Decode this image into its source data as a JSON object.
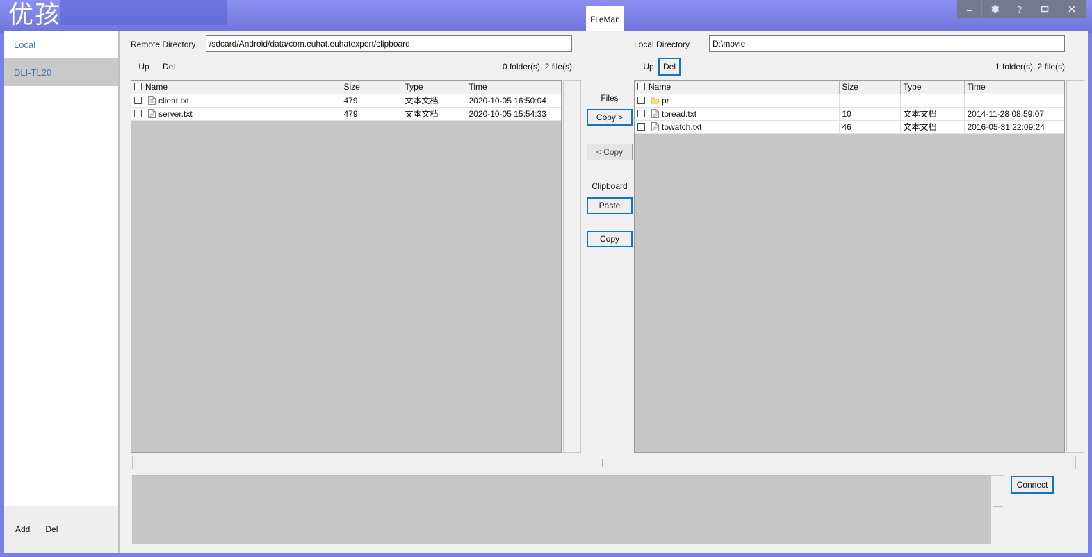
{
  "window": {
    "logo_text": "优孩",
    "controls": [
      {
        "name": "minimize",
        "glyph": "minimize-icon"
      },
      {
        "name": "settings",
        "glyph": "gear-icon"
      },
      {
        "name": "help",
        "glyph": "question-icon"
      },
      {
        "name": "maximize",
        "glyph": "maximize-icon"
      },
      {
        "name": "close",
        "glyph": "close-icon"
      }
    ]
  },
  "tab": {
    "label": "FileMan"
  },
  "sidebar": {
    "items": [
      {
        "label": "Local",
        "selected": false
      },
      {
        "label": "DLI-TL20",
        "selected": true
      }
    ],
    "footer": {
      "add_label": "Add",
      "del_label": "Del"
    }
  },
  "remote": {
    "dir_label": "Remote Directory",
    "dir_value": "/sdcard/Android/data/com.euhat.euhatexpert/clipboard",
    "up_label": "Up",
    "del_label": "Del",
    "count_text": "0 folder(s), 2 file(s)",
    "columns": [
      "Name",
      "Size",
      "Type",
      "Time"
    ],
    "rows": [
      {
        "icon": "file-icon",
        "name": "client.txt",
        "size": "479",
        "type": "文本文档",
        "time": "2020-10-05 16:50:04"
      },
      {
        "icon": "file-icon",
        "name": "server.txt",
        "size": "479",
        "type": "文本文档",
        "time": "2020-10-05 15:54:33"
      }
    ]
  },
  "local": {
    "dir_label": "Local Directory",
    "dir_value": "D:\\movie",
    "up_label": "Up",
    "del_label": "Del",
    "count_text": "1 folder(s), 2 file(s)",
    "columns": [
      "Name",
      "Size",
      "Type",
      "Time"
    ],
    "rows": [
      {
        "icon": "folder-icon",
        "name": "pr",
        "size": "",
        "type": "",
        "time": ""
      },
      {
        "icon": "file-icon",
        "name": "toread.txt",
        "size": "10",
        "type": "文本文档",
        "time": "2014-11-28 08:59:07"
      },
      {
        "icon": "file-icon",
        "name": "towatch.txt",
        "size": "46",
        "type": "文本文档",
        "time": "2016-05-31 22:09:24"
      }
    ]
  },
  "center": {
    "files_label": "Files",
    "copy_right_label": "Copy >",
    "copy_left_label": "< Copy",
    "clipboard_label": "Clipboard",
    "paste_label": "Paste",
    "copy_label": "Copy"
  },
  "bottom": {
    "splitter_grip": "||",
    "connect_label": "Connect",
    "log_text": ""
  },
  "colors": {
    "titlebar_top": "#8b8ff2",
    "titlebar_bottom": "#6f74d8",
    "accent_focus": "#1673c4",
    "sidebar_link": "#3d7ab5",
    "sidebar_selected_bg": "#c9c9c9",
    "table_empty_bg": "#c6c6c6",
    "folder_icon": "#ffd979"
  }
}
